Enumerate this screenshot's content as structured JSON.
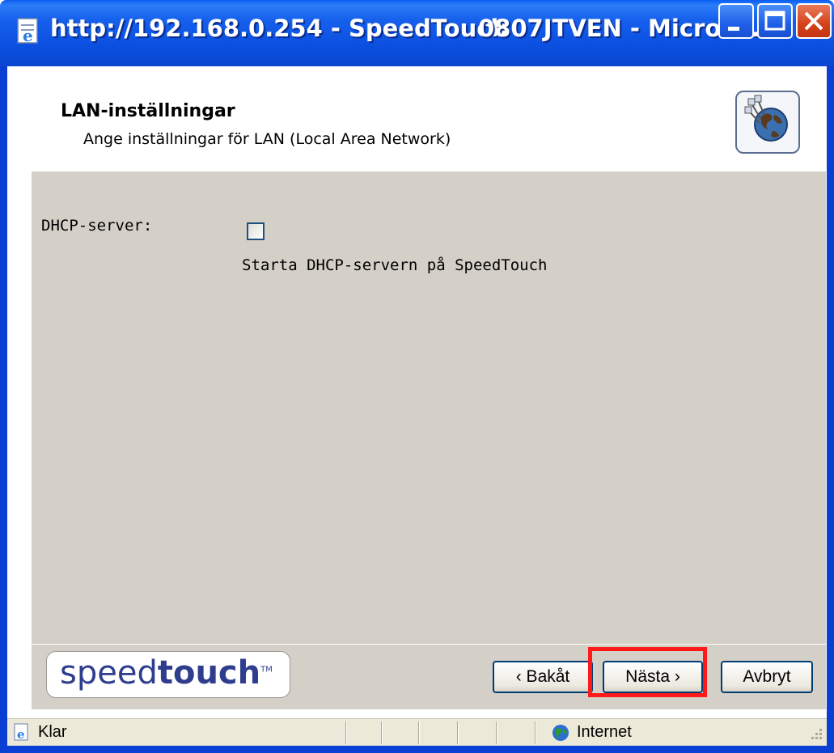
{
  "window": {
    "title_left": "http://192.168.0.254 - SpeedTouch",
    "title_right": "0807JTVEN - Microso...",
    "minimize_icon": "minimize-icon",
    "maximize_icon": "maximize-icon",
    "close_icon": "close-icon"
  },
  "header": {
    "title": "LAN-inställningar",
    "subtitle": "Ange inställningar för LAN (Local Area Network)",
    "icon": "lan-globe-icon"
  },
  "form": {
    "dhcp_label": "DHCP-server:",
    "dhcp_checked": false,
    "dhcp_option_text": "Starta DHCP-servern på SpeedTouch"
  },
  "footer": {
    "logo_light": "speed",
    "logo_bold": "touch",
    "logo_tm": "TM",
    "back_label": "‹ Bakåt",
    "next_label": "Nästa ›",
    "cancel_label": "Avbryt"
  },
  "statusbar": {
    "status_text": "Klar",
    "zone_text": "Internet"
  },
  "colors": {
    "titlebar": "#0b4fe0",
    "content_bg": "#d4d0c8",
    "highlight": "#ff1a1a",
    "logo_blue": "#2f3d8e"
  }
}
